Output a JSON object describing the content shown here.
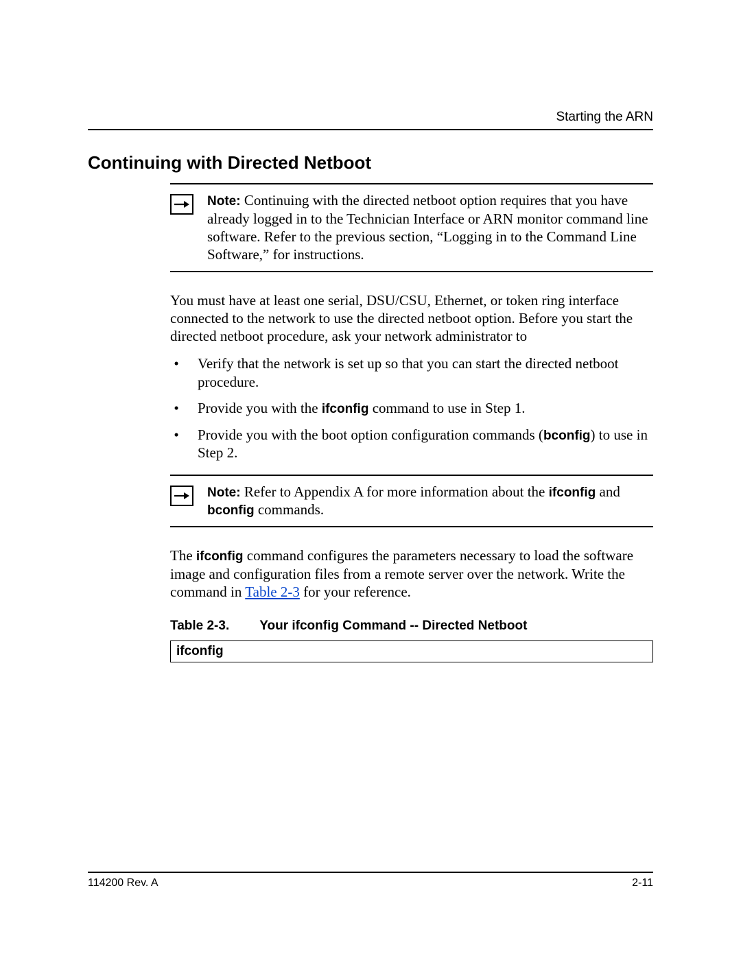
{
  "header": {
    "label": "Starting the ARN"
  },
  "section": {
    "title": "Continuing with Directed Netboot"
  },
  "note1": {
    "label": "Note:",
    "content": " Continuing with the directed netboot option requires that you have already logged in to the Technician Interface or ARN monitor command line software. Refer to the previous section, “Logging in to the Command Line Software,” for instructions."
  },
  "paragraph1": "You must have at least one serial, DSU/CSU, Ethernet, or token ring interface connected to the network to use the directed netboot option. Before you start the directed netboot procedure, ask your network administrator to",
  "bullets": {
    "b1": "Verify that the network is set up so that you can start the directed netboot procedure.",
    "b2_pre": "Provide you with the ",
    "b2_cmd": "ifconfig",
    "b2_post": " command to use in Step 1.",
    "b3_pre": "Provide you with the boot option configuration commands (",
    "b3_cmd": "bconfig",
    "b3_post": ") to use in Step 2."
  },
  "note2": {
    "label": "Note:",
    "pre": " Refer to Appendix A for more information about the ",
    "cmd1": "ifconfig",
    "mid": " and ",
    "cmd2": "bconfig",
    "post": " commands."
  },
  "paragraph2": {
    "pre": "The ",
    "cmd": "ifconfig",
    "mid": " command configures the parameters necessary to load the software image and configuration files from a remote server over the network. Write the command in ",
    "link": "Table 2-3",
    "post": " for your reference."
  },
  "table": {
    "caption_num": "Table 2-3.",
    "caption_title": "Your ifconfig Command -- Directed Netboot",
    "cell": "ifconfig"
  },
  "footer": {
    "left": "114200 Rev. A",
    "right": "2-11"
  }
}
